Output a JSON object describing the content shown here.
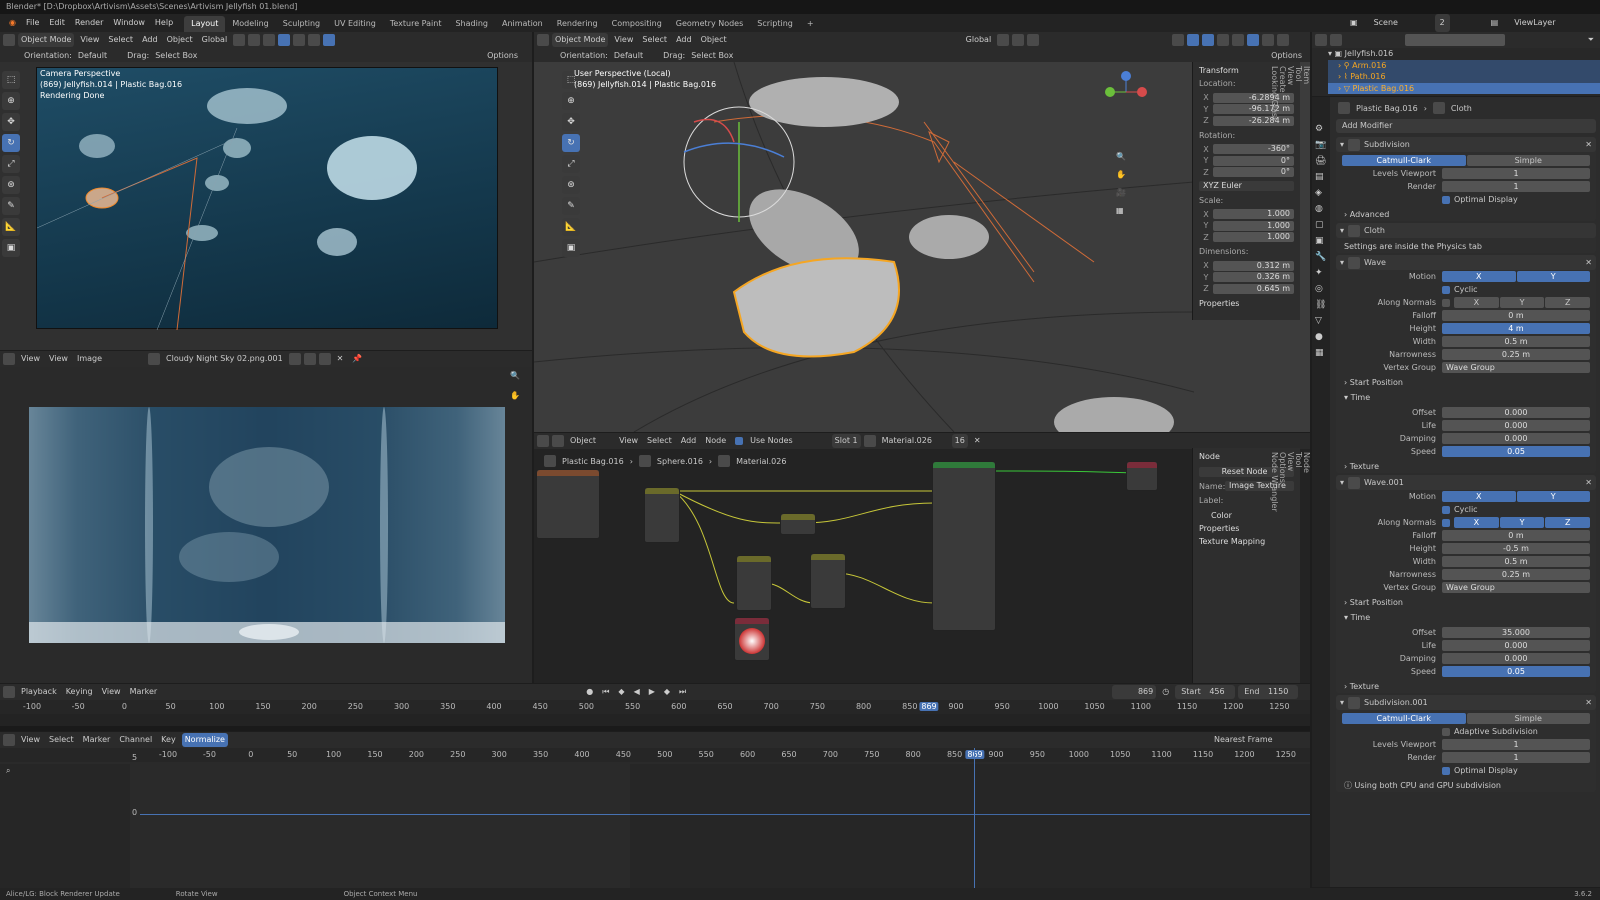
{
  "title": "Blender* [D:\\Dropbox\\Artivism\\Assets\\Scenes\\Artivism Jellyfish 01.blend]",
  "menu": [
    "File",
    "Edit",
    "Render",
    "Window",
    "Help"
  ],
  "workspaces": [
    "Layout",
    "Modeling",
    "Sculpting",
    "UV Editing",
    "Texture Paint",
    "Shading",
    "Animation",
    "Rendering",
    "Compositing",
    "Geometry Nodes",
    "Scripting"
  ],
  "active_workspace": "Layout",
  "scene": {
    "name": "Scene",
    "count": "2",
    "view_layer": "ViewLayer"
  },
  "outliner": [
    {
      "label": "Jellyfish.016"
    },
    {
      "label": "Arm.016"
    },
    {
      "label": "Path.016"
    },
    {
      "label": "Plastic Bag.016"
    }
  ],
  "camview": {
    "mode": "Object Mode",
    "view": "View",
    "select": "Select",
    "add": "Add",
    "object": "Object",
    "orient": "Global",
    "orientation_label": "Orientation:",
    "orientation": "Default",
    "drag_label": "Drag:",
    "drag": "Select Box",
    "options": "Options",
    "overlay1": "Camera Perspective",
    "overlay2": "(869) Jellyfish.014 | Plastic Bag.016",
    "overlay3": "Rendering Done"
  },
  "image_editor": {
    "view": "View",
    "view2": "View",
    "image": "Image",
    "image_name": "Cloudy Night Sky 02.png.001"
  },
  "main3d": {
    "mode": "Object Mode",
    "view": "View",
    "select": "Select",
    "add": "Add",
    "object": "Object",
    "orient": "Global",
    "orientation_label": "Orientation:",
    "orientation": "Default",
    "drag_label": "Drag:",
    "drag": "Select Box",
    "options": "Options",
    "overlay1": "User Perspective (Local)",
    "overlay2": "(869) Jellyfish.014 | Plastic Bag.016"
  },
  "npanel": {
    "transform": "Transform",
    "location": "Location:",
    "loc": [
      "-6.2894 m",
      "-96.172 m",
      "-26.284 m"
    ],
    "rotation": "Rotation:",
    "rot": [
      "-360°",
      "0°",
      "0°"
    ],
    "euler": "XYZ Euler",
    "scale": "Scale:",
    "scl": [
      "1.000",
      "1.000",
      "1.000"
    ],
    "dimensions": "Dimensions:",
    "dim": [
      "0.312 m",
      "0.326 m",
      "0.645 m"
    ],
    "properties": "Properties",
    "axes": [
      "X",
      "Y",
      "Z"
    ],
    "tabs": [
      "Item",
      "Tool",
      "View",
      "Create",
      "Looking Glass"
    ]
  },
  "node_editor": {
    "object": "Object",
    "view": "View",
    "select": "Select",
    "add": "Add",
    "node": "Node",
    "use_nodes": "Use Nodes",
    "slot": "Slot 1",
    "material": "Material.026",
    "users": "16",
    "bc_object": "Plastic Bag.016",
    "bc_mesh": "Sphere.016",
    "bc_mat": "Material.026",
    "side_node": "Node",
    "reset": "Reset Node",
    "name_label": "Name:",
    "name": "Image Texture",
    "label_label": "Label:",
    "color": "Color",
    "properties": "Properties",
    "texmap": "Texture Mapping",
    "tabs": [
      "Node",
      "Tool",
      "View",
      "Options",
      "Node Wrangler"
    ]
  },
  "properties": {
    "breadcrumb_obj": "Plastic Bag.016",
    "breadcrumb_mod": "Cloth",
    "add_modifier": "Add Modifier",
    "subdiv": {
      "name": "Subdivision",
      "catmull": "Catmull-Clark",
      "simple": "Simple",
      "levels_label": "Levels Viewport",
      "levels": "1",
      "render_label": "Render",
      "render": "1",
      "optimal": "Optimal Display",
      "advanced": "Advanced"
    },
    "cloth": {
      "name": "Cloth",
      "note": "Settings are inside the Physics tab"
    },
    "wave": {
      "name": "Wave",
      "motion": "Motion",
      "x": "X",
      "y": "Y",
      "z": "Z",
      "cyclic": "Cyclic",
      "along": "Along Normals",
      "falloff_l": "Falloff",
      "falloff": "0 m",
      "height_l": "Height",
      "height": "4 m",
      "width_l": "Width",
      "width": "0.5 m",
      "narrow_l": "Narrowness",
      "narrow": "0.25 m",
      "vgroup_l": "Vertex Group",
      "vgroup": "Wave Group",
      "start": "Start Position",
      "time": "Time",
      "offset_l": "Offset",
      "offset": "0.000",
      "life_l": "Life",
      "life": "0.000",
      "damp_l": "Damping",
      "damp": "0.000",
      "speed_l": "Speed",
      "speed": "0.05",
      "texture": "Texture"
    },
    "wave2": {
      "name": "Wave.001",
      "motion": "Motion",
      "x": "X",
      "y": "Y",
      "z": "Z",
      "cyclic": "Cyclic",
      "along": "Along Normals",
      "falloff_l": "Falloff",
      "falloff": "0 m",
      "height_l": "Height",
      "height": "-0.5 m",
      "width_l": "Width",
      "width": "0.5 m",
      "narrow_l": "Narrowness",
      "narrow": "0.25 m",
      "vgroup_l": "Vertex Group",
      "vgroup": "Wave Group",
      "start": "Start Position",
      "time": "Time",
      "offset_l": "Offset",
      "offset": "35.000",
      "life_l": "Life",
      "life": "0.000",
      "damp_l": "Damping",
      "damp": "0.000",
      "speed_l": "Speed",
      "speed": "0.05",
      "texture": "Texture"
    },
    "subdiv2": {
      "name": "Subdivision.001",
      "catmull": "Catmull-Clark",
      "simple": "Simple",
      "adaptive": "Adaptive Subdivision",
      "levels_label": "Levels Viewport",
      "levels": "1",
      "render_label": "Render",
      "render": "1",
      "optimal": "Optimal Display",
      "gpu": "Using both CPU and GPU subdivision"
    }
  },
  "timeline": {
    "playback": "Playback",
    "keying": "Keying",
    "view": "View",
    "marker": "Marker",
    "frame": "869",
    "start_l": "Start",
    "start": "456",
    "end_l": "End",
    "end": "1150",
    "ticks": [
      "-100",
      "-50",
      "0",
      "50",
      "100",
      "150",
      "200",
      "250",
      "300",
      "350",
      "400",
      "450",
      "500",
      "550",
      "600",
      "650",
      "700",
      "750",
      "800",
      "850",
      "900",
      "950",
      "1000",
      "1050",
      "1100",
      "1150",
      "1200",
      "1250"
    ]
  },
  "graph": {
    "view": "View",
    "select": "Select",
    "marker": "Marker",
    "channel": "Channel",
    "key": "Key",
    "normalize": "Normalize",
    "nearest": "Nearest Frame",
    "ticks": [
      "-100",
      "-50",
      "0",
      "50",
      "100",
      "150",
      "200",
      "250",
      "300",
      "350",
      "400",
      "450",
      "500",
      "550",
      "600",
      "650",
      "700",
      "750",
      "800",
      "850",
      "900",
      "950",
      "1000",
      "1050",
      "1100",
      "1150",
      "1200",
      "1250"
    ],
    "y5": "5",
    "y0": "0"
  },
  "status": {
    "s1": "Alice/LG: Block Renderer Update",
    "s2": "Rotate View",
    "s3": "Object Context Menu",
    "version": "3.6.2"
  },
  "colors": {
    "accent": "#4772b3",
    "select": "#f5a623",
    "bg": "#303030"
  }
}
